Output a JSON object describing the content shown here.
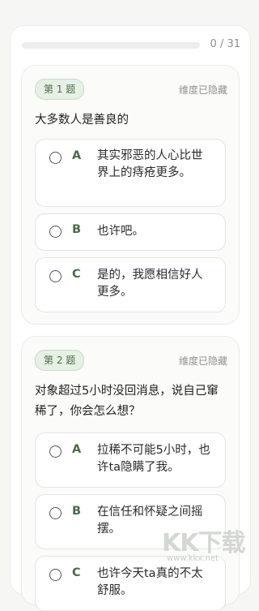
{
  "progress": {
    "count": "0 / 31",
    "fraction": 0.0
  },
  "questions": [
    {
      "badge": "第 1 题",
      "dimension": "维度已隐藏",
      "text": "大多数人是善良的",
      "options": [
        {
          "letter": "A",
          "text": "其实邪恶的人心比世界上的痔疮更多。"
        },
        {
          "letter": "B",
          "text": "也许吧。"
        },
        {
          "letter": "C",
          "text": "是的，我愿相信好人更多。"
        }
      ]
    },
    {
      "badge": "第 2 题",
      "dimension": "维度已隐藏",
      "text": "对象超过5小时没回消息，说自己窜稀了，你会怎么想？",
      "options": [
        {
          "letter": "A",
          "text": "拉稀不可能5小时，也许ta隐瞒了我。"
        },
        {
          "letter": "B",
          "text": "在信任和怀疑之间摇摆。"
        },
        {
          "letter": "C",
          "text": "也许今天ta真的不太舒服。"
        }
      ]
    }
  ],
  "watermark": {
    "logo": "KK下载",
    "url": "www.kkx.net"
  }
}
